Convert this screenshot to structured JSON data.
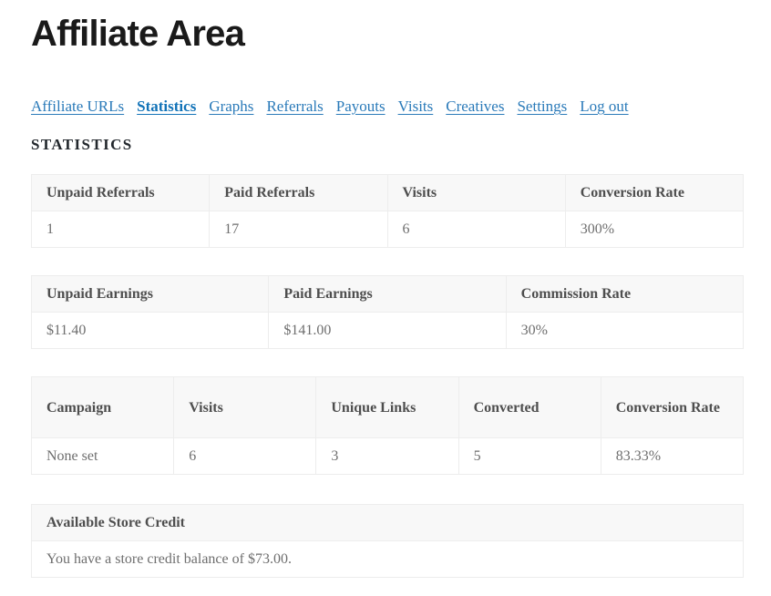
{
  "header": {
    "title": "Affiliate Area"
  },
  "nav": {
    "items": [
      {
        "label": "Affiliate URLs",
        "active": false
      },
      {
        "label": "Statistics",
        "active": true
      },
      {
        "label": "Graphs",
        "active": false
      },
      {
        "label": "Referrals",
        "active": false
      },
      {
        "label": "Payouts",
        "active": false
      },
      {
        "label": "Visits",
        "active": false
      },
      {
        "label": "Creatives",
        "active": false
      },
      {
        "label": "Settings",
        "active": false
      },
      {
        "label": "Log out",
        "active": false
      }
    ]
  },
  "section": {
    "heading": "Statistics"
  },
  "referrals_table": {
    "headers": [
      "Unpaid Referrals",
      "Paid Referrals",
      "Visits",
      "Conversion Rate"
    ],
    "rows": [
      [
        "1",
        "17",
        "6",
        "300%"
      ]
    ]
  },
  "earnings_table": {
    "headers": [
      "Unpaid Earnings",
      "Paid Earnings",
      "Commission Rate"
    ],
    "rows": [
      [
        "$11.40",
        "$141.00",
        "30%"
      ]
    ]
  },
  "campaigns_table": {
    "headers": [
      "Campaign",
      "Visits",
      "Unique Links",
      "Converted",
      "Conversion Rate"
    ],
    "rows": [
      [
        "None set",
        "6",
        "3",
        "5",
        "83.33%"
      ]
    ]
  },
  "store_credit": {
    "heading": "Available Store Credit",
    "message": "You have a store credit balance of $73.00."
  },
  "colors": {
    "link": "#2a7ab9",
    "link_active": "#1273b8",
    "title": "#1a1a1a",
    "table_header_bg": "#f8f8f8",
    "table_border": "#ededed",
    "body_text": "#6e6e6e"
  }
}
